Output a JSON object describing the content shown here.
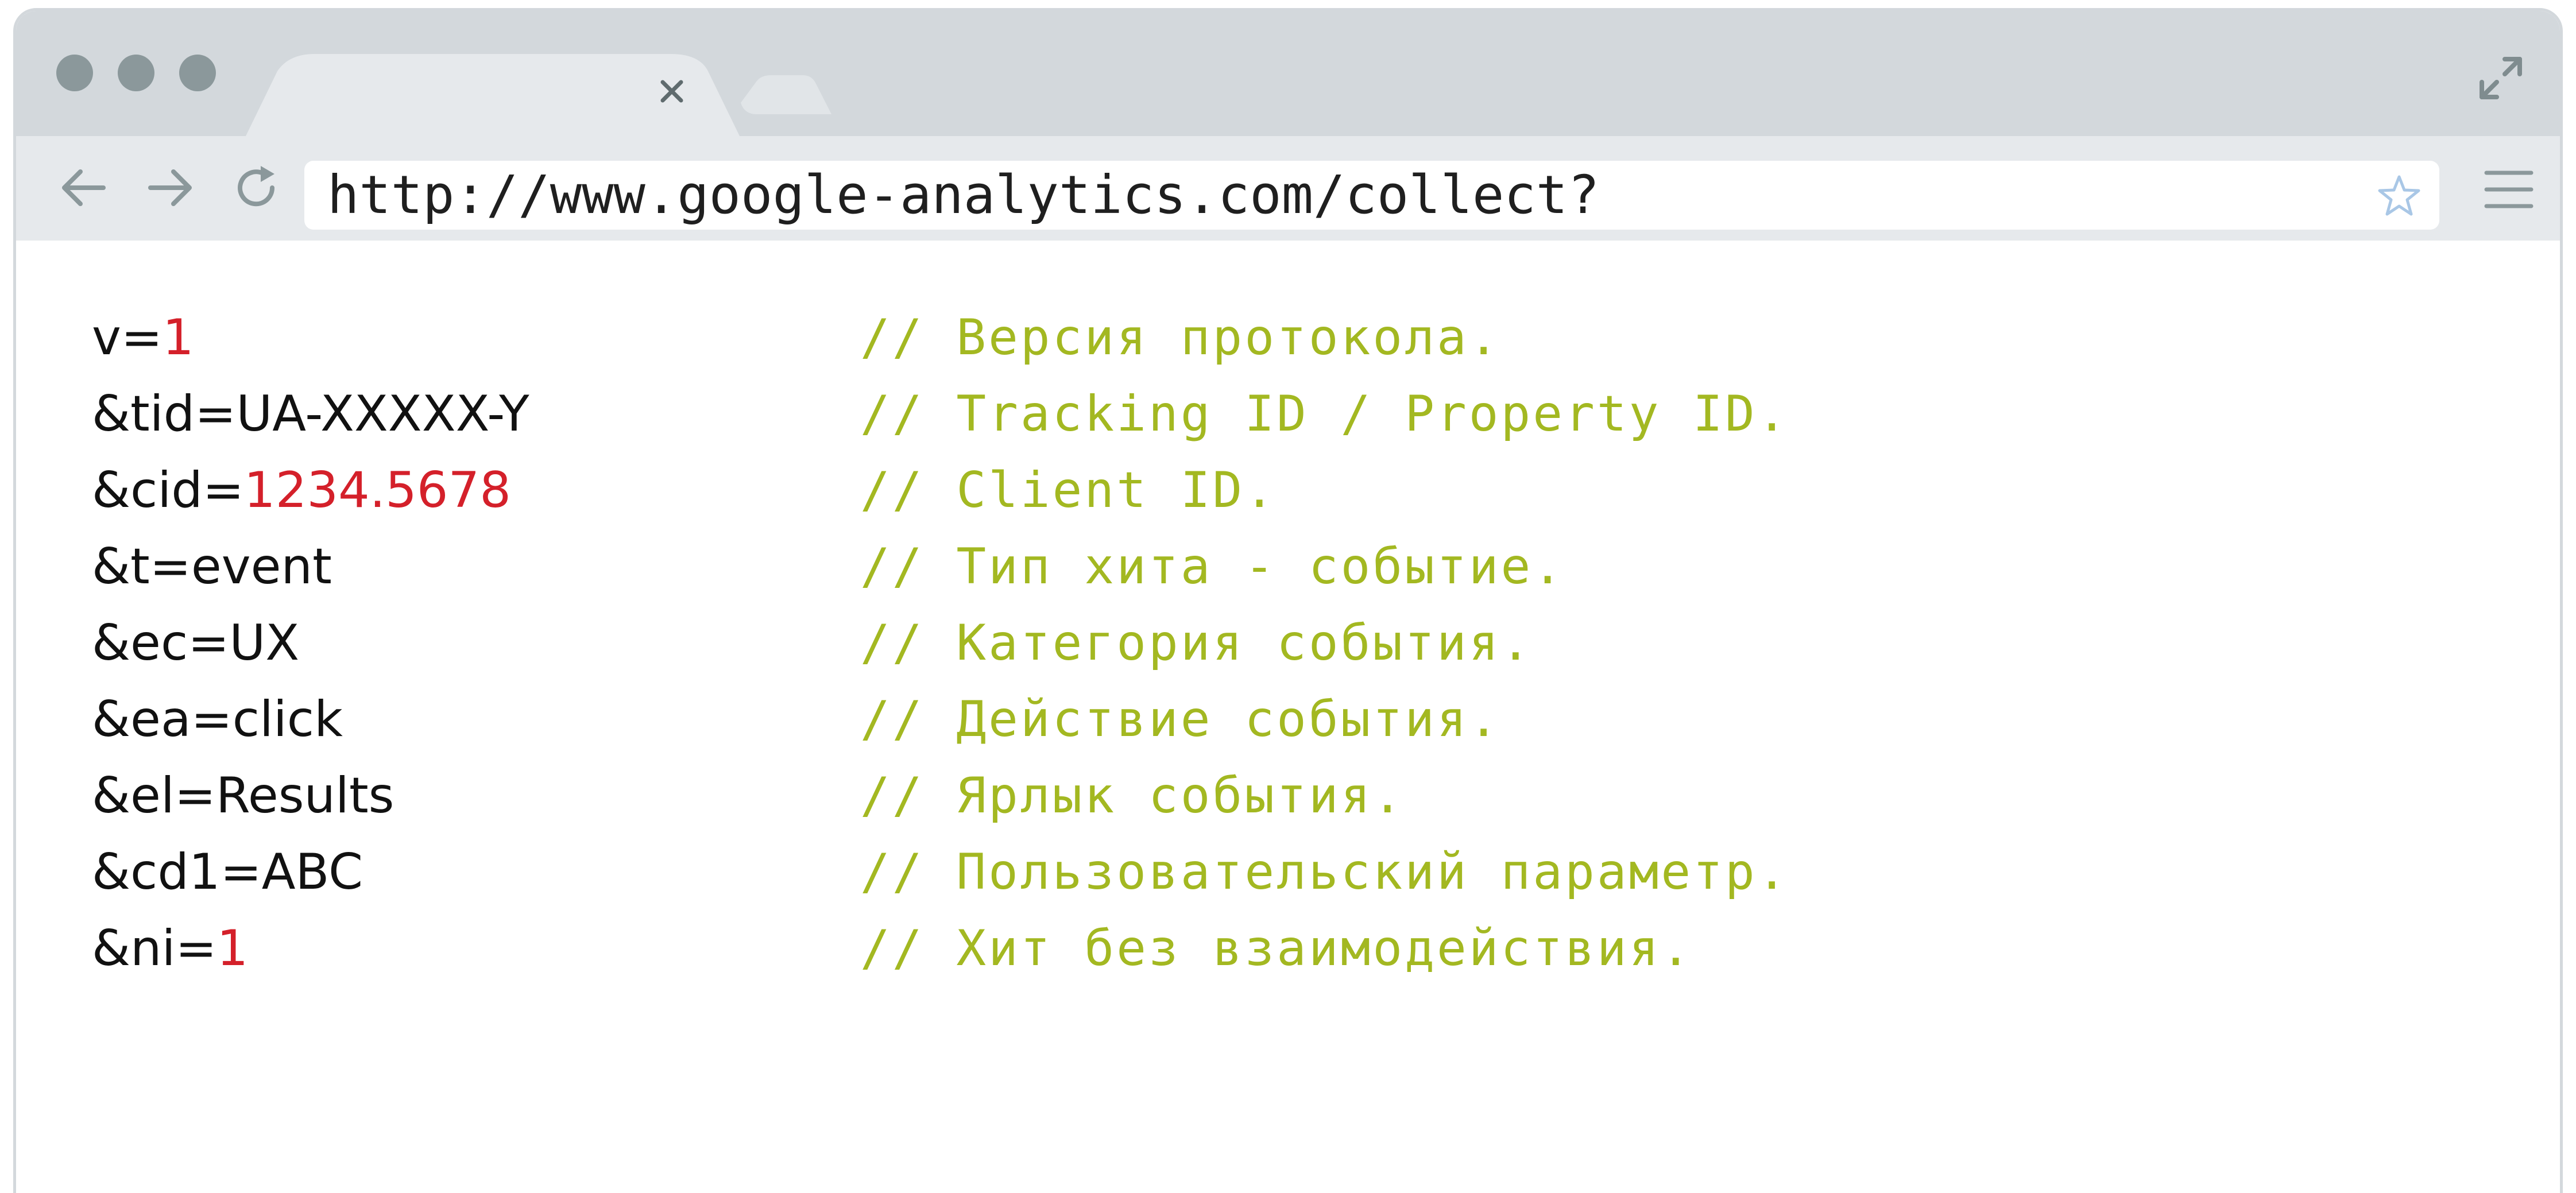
{
  "browser": {
    "address_url": "http://www.google-analytics.com/collect?",
    "tab_close_icon": "close-icon",
    "icons": {
      "back": "arrow-left-icon",
      "forward": "arrow-right-icon",
      "reload": "reload-icon",
      "bookmark": "star-icon",
      "menu": "hamburger-menu-icon",
      "expand": "expand-icon"
    },
    "colors": {
      "chrome": "#d3d8dc",
      "toolbar": "#e6e9ec",
      "traffic_dots": "#8b989b"
    }
  },
  "code": {
    "colors": {
      "param": "#111111",
      "number": "#d4202a",
      "comment": "#a3b821"
    },
    "lines": [
      {
        "key": "v=",
        "value": "1",
        "value_highlight": true,
        "comment": "// Версия протокола."
      },
      {
        "key": "&tid=",
        "value": "UA-XXXXX-Y",
        "value_highlight": false,
        "comment": "// Tracking ID / Property ID."
      },
      {
        "key": "&cid=",
        "value": "1234.5678",
        "value_highlight": true,
        "comment": "// Client ID."
      },
      {
        "key": "&t=",
        "value": "event",
        "value_highlight": false,
        "comment": "// Тип хита - событие."
      },
      {
        "key": "&ec=",
        "value": "UX",
        "value_highlight": false,
        "comment": "// Категория события."
      },
      {
        "key": "&ea=",
        "value": "click",
        "value_highlight": false,
        "comment": "// Действие события."
      },
      {
        "key": "&el=",
        "value": "Results",
        "value_highlight": false,
        "comment": "// Ярлык события."
      },
      {
        "key": "&cd1=",
        "value": "ABC",
        "value_highlight": false,
        "comment": "// Пользовательский параметр."
      },
      {
        "key": "&ni=",
        "value": "1",
        "value_highlight": true,
        "comment": "// Хит без взаимодействия."
      }
    ]
  }
}
